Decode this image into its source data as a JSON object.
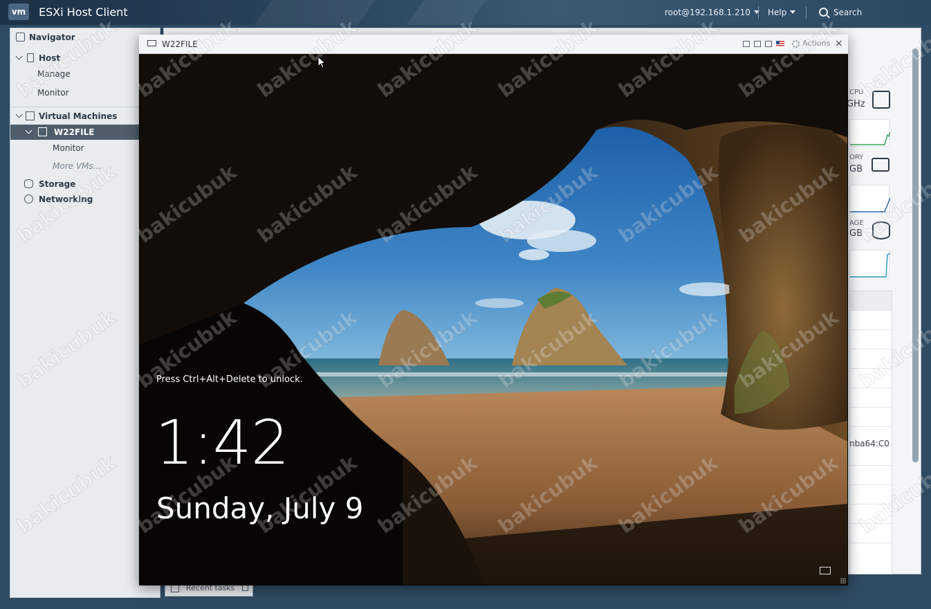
{
  "header": {
    "app_title": "ESXi Host Client",
    "logo_text": "vm",
    "user_menu": "root@192.168.1.210",
    "help_menu": "Help",
    "search_label": "Search",
    "colors": {
      "bar": "#2a455e",
      "text": "#ffffff"
    }
  },
  "navigator": {
    "title": "Navigator",
    "host": {
      "label": "Host",
      "children": [
        "Manage",
        "Monitor"
      ]
    },
    "virtual_machines": {
      "label": "Virtual Machines",
      "selected_vm": "W22FILE",
      "vm_children": [
        "Monitor"
      ],
      "more": "More VMs..."
    },
    "storage": "Storage",
    "networking": "Networking",
    "recent_tasks": "Recent tasks"
  },
  "background_panel": {
    "cpu_label": "CPU",
    "cpu_value": "GHz",
    "memory_label": "ORY",
    "memory_value": "GB",
    "storage_label": "AGE",
    "storage_value": "GB",
    "adapter_text": "nba64:C0"
  },
  "console": {
    "title": "W22FILE",
    "actions_label": "Actions",
    "close_glyph": "×",
    "lock_message": "Press Ctrl+Alt+Delete to unlock.",
    "time": "1:42",
    "date": "Sunday, July 9"
  },
  "watermark": {
    "text": "bakicubuk"
  },
  "icons": {
    "nav_compass": "navigator-compass-icon",
    "host": "host-icon",
    "vms": "virtual-machines-icon",
    "vm": "vm-icon",
    "storage": "storage-database-icon",
    "network": "networking-icon",
    "search": "search-icon",
    "monitor": "console-monitor-icon",
    "gear": "gear-icon",
    "close": "close-icon",
    "cpu": "cpu-chip-icon",
    "memory": "memory-module-icon",
    "db": "datastore-icon"
  }
}
